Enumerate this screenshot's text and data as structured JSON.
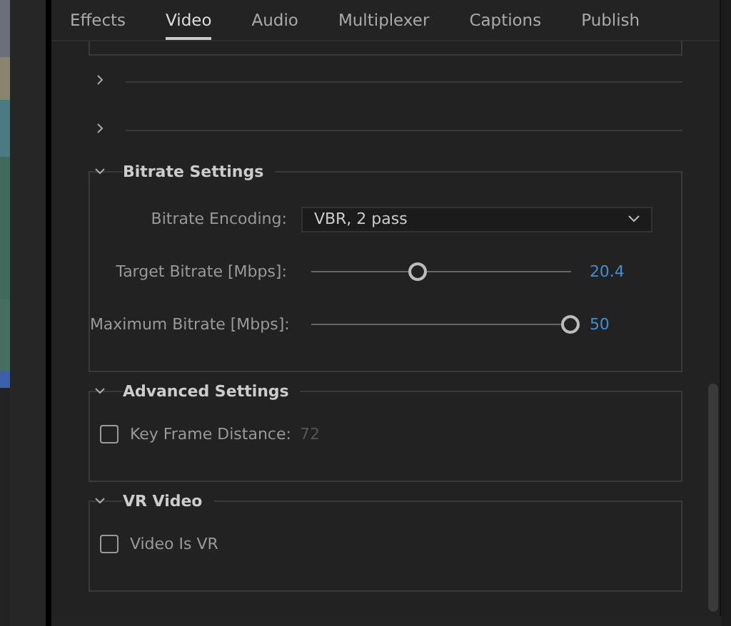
{
  "tabs": [
    {
      "label": "Effects",
      "selected": false
    },
    {
      "label": "Video",
      "selected": true
    },
    {
      "label": "Audio",
      "selected": false
    },
    {
      "label": "Multiplexer",
      "selected": false
    },
    {
      "label": "Captions",
      "selected": false
    },
    {
      "label": "Publish",
      "selected": false
    }
  ],
  "collapsed_sections": [
    {
      "expanded": false
    },
    {
      "expanded": false
    }
  ],
  "sections": [
    {
      "title": "Bitrate Settings",
      "expanded": true,
      "rows": [
        {
          "kind": "dropdown",
          "label": "Bitrate Encoding:",
          "value": "VBR, 2 pass"
        },
        {
          "kind": "slider",
          "label": "Target Bitrate [Mbps]:",
          "level": 0.41,
          "reading": "20.4"
        },
        {
          "kind": "slider",
          "label": "Maximum Bitrate [Mbps]:",
          "level": 1,
          "reading": "50"
        }
      ]
    },
    {
      "title": "Advanced Settings",
      "expanded": true,
      "rows": [
        {
          "kind": "checkbox",
          "label": "Key Frame Distance:",
          "checked": false,
          "value": "72"
        }
      ]
    },
    {
      "title": "VR Video",
      "expanded": true,
      "rows": [
        {
          "kind": "checkbox",
          "label": "Video Is VR",
          "checked": false
        }
      ]
    }
  ]
}
